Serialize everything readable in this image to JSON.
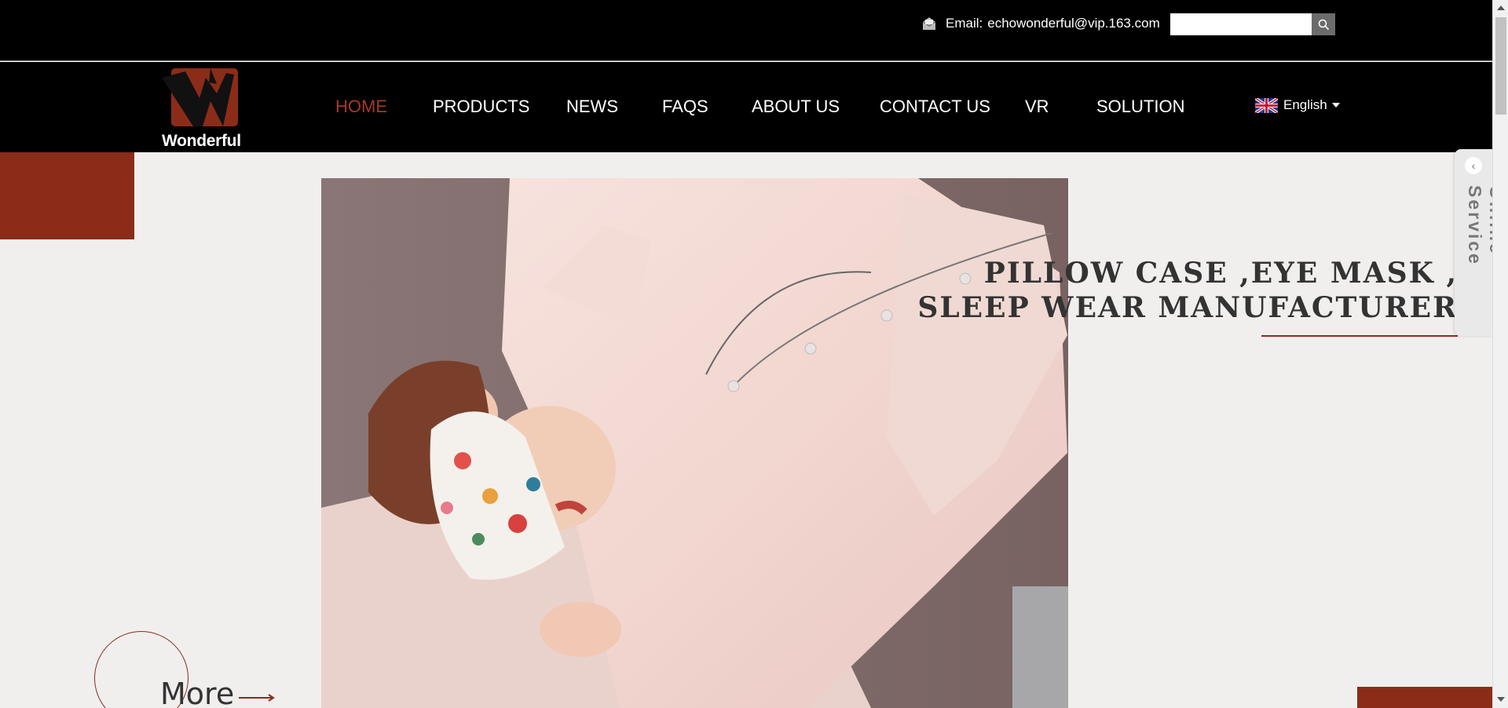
{
  "header": {
    "email_label": "Email:",
    "email_value": "echowonderful@vip.163.com",
    "search_placeholder": "",
    "search_icon": "magnifier-icon"
  },
  "logo": {
    "text": "Wonderful"
  },
  "nav": {
    "items": [
      {
        "label": "HOME",
        "active": true
      },
      {
        "label": "PRODUCTS"
      },
      {
        "label": "NEWS"
      },
      {
        "label": "FAQS"
      },
      {
        "label": "ABOUT US"
      },
      {
        "label": "CONTACT US"
      },
      {
        "label": "VR"
      },
      {
        "label": "SOLUTION"
      }
    ],
    "language": "English"
  },
  "hero": {
    "headline_line1": "PILLOW CASE ,EYE MASK ,",
    "headline_line2": "SLEEP WEAR MANUFACTURER",
    "more_label": "More"
  },
  "online_service": {
    "label": "Online Service",
    "toggle_icon": "chevron-left-icon"
  },
  "colors": {
    "accent": "#8b2c18",
    "active_nav": "#a33a27",
    "topbar": "#000000"
  }
}
